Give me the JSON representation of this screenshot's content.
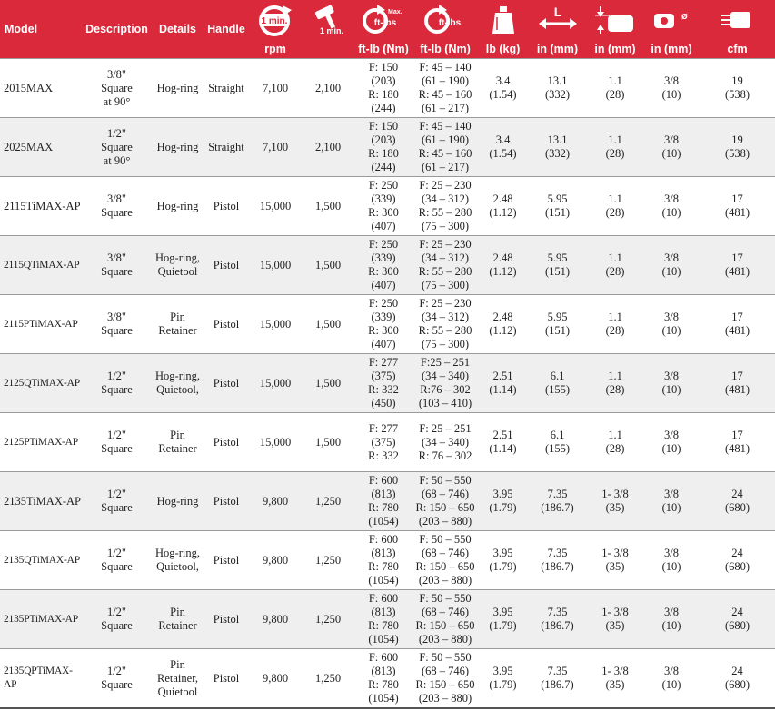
{
  "header": {
    "model": "Model",
    "description": "Description",
    "details": "Details",
    "handle": "Handle",
    "icon_1min_a": "1 min.",
    "icon_1min_b": "1 min.",
    "icon_max_label": "Max.",
    "icon_ftlbs_a": "ft-lbs",
    "icon_ftlbs_b": "ft-lbs",
    "icon_L": "L",
    "icon_diam": "ø",
    "units": [
      "rpm",
      "",
      "ft-lb (Nm)",
      "ft-lb (Nm)",
      "lb (kg)",
      "in (mm)",
      "in (mm)",
      "in (mm)",
      "cfm"
    ]
  },
  "rows": [
    {
      "model": "2015MAX",
      "description": [
        "3/8\"",
        "Square",
        "at 90°"
      ],
      "details": [
        "Hog-ring"
      ],
      "handle": "Straight",
      "rpm": "7,100",
      "bpm": "2,100",
      "torque_max": [
        "F: 150",
        "(203)",
        "R: 180",
        "(244)"
      ],
      "torque_range": [
        "F: 45 – 140",
        "(61 – 190)",
        "R: 45 – 160",
        "(61 – 217)"
      ],
      "weight": [
        "3.4",
        "(1.54)"
      ],
      "length": [
        "13.1",
        "(332)"
      ],
      "side": [
        "1.1",
        "(28)"
      ],
      "inlet": [
        "3/8",
        "(10)"
      ],
      "air": [
        "19",
        "(538)"
      ]
    },
    {
      "model": "2025MAX",
      "description": [
        "1/2\"",
        "Square",
        "at 90°"
      ],
      "details": [
        "Hog-ring"
      ],
      "handle": "Straight",
      "rpm": "7,100",
      "bpm": "2,100",
      "torque_max": [
        "F: 150",
        "(203)",
        "R: 180",
        "(244)"
      ],
      "torque_range": [
        "F: 45 – 140",
        "(61 – 190)",
        "R: 45 – 160",
        "(61 – 217)"
      ],
      "weight": [
        "3.4",
        "(1.54)"
      ],
      "length": [
        "13.1",
        "(332)"
      ],
      "side": [
        "1.1",
        "(28)"
      ],
      "inlet": [
        "3/8",
        "(10)"
      ],
      "air": [
        "19",
        "(538)"
      ]
    },
    {
      "model": "2115TiMAX-AP",
      "description": [
        "3/8\"",
        "Square"
      ],
      "details": [
        "Hog-ring"
      ],
      "handle": "Pistol",
      "rpm": "15,000",
      "bpm": "1,500",
      "torque_max": [
        "F: 250",
        "(339)",
        "R: 300",
        "(407)"
      ],
      "torque_range": [
        "F: 25 – 230",
        "(34 – 312)",
        "R: 55 – 280",
        "(75 – 300)"
      ],
      "weight": [
        "2.48",
        "(1.12)"
      ],
      "length": [
        "5.95",
        "(151)"
      ],
      "side": [
        "1.1",
        "(28)"
      ],
      "inlet": [
        "3/8",
        "(10)"
      ],
      "air": [
        "17",
        "(481)"
      ]
    },
    {
      "model": "2115QTiMAX-AP",
      "description": [
        "3/8\"",
        "Square"
      ],
      "details": [
        "Hog-ring,",
        "Quietool"
      ],
      "handle": "Pistol",
      "rpm": "15,000",
      "bpm": "1,500",
      "torque_max": [
        "F: 250",
        "(339)",
        "R: 300",
        "(407)"
      ],
      "torque_range": [
        "F: 25 – 230",
        "(34 – 312)",
        "R: 55 – 280",
        "(75 – 300)"
      ],
      "weight": [
        "2.48",
        "(1.12)"
      ],
      "length": [
        "5.95",
        "(151)"
      ],
      "side": [
        "1.1",
        "(28)"
      ],
      "inlet": [
        "3/8",
        "(10)"
      ],
      "air": [
        "17",
        "(481)"
      ]
    },
    {
      "model": "2115PTiMAX-AP",
      "description": [
        "3/8\"",
        "Square"
      ],
      "details": [
        "Pin",
        "Retainer"
      ],
      "handle": "Pistol",
      "rpm": "15,000",
      "bpm": "1,500",
      "torque_max": [
        "F: 250",
        "(339)",
        "R: 300",
        "(407)"
      ],
      "torque_range": [
        "F: 25 – 230",
        "(34 – 312)",
        "R: 55 – 280",
        "(75 – 300)"
      ],
      "weight": [
        "2.48",
        "(1.12)"
      ],
      "length": [
        "5.95",
        "(151)"
      ],
      "side": [
        "1.1",
        "(28)"
      ],
      "inlet": [
        "3/8",
        "(10)"
      ],
      "air": [
        "17",
        "(481)"
      ]
    },
    {
      "model": "2125QTiMAX-AP",
      "description": [
        "1/2\"",
        "Square"
      ],
      "details": [
        "Hog-ring,",
        "Quietool,"
      ],
      "handle": "Pistol",
      "rpm": "15,000",
      "bpm": "1,500",
      "torque_max": [
        "F: 277",
        "(375)",
        "R: 332",
        "(450)"
      ],
      "torque_range": [
        "F:25 – 251",
        "(34 – 340)",
        "R:76 – 302",
        "(103 – 410)"
      ],
      "weight": [
        "2.51",
        "(1.14)"
      ],
      "length": [
        "6.1",
        "(155)"
      ],
      "side": [
        "1.1",
        "(28)"
      ],
      "inlet": [
        "3/8",
        "(10)"
      ],
      "air": [
        "17",
        "(481)"
      ]
    },
    {
      "model": "2125PTiMAX-AP",
      "description": [
        "1/2\"",
        "Square"
      ],
      "details": [
        "Pin",
        "Retainer"
      ],
      "handle": "Pistol",
      "rpm": "15,000",
      "bpm": "1,500",
      "torque_max": [
        "F: 277",
        "(375)",
        "R: 332"
      ],
      "torque_range": [
        "F: 25 – 251",
        "(34 – 340)",
        "R: 76 – 302"
      ],
      "weight": [
        "2.51",
        "(1.14)"
      ],
      "length": [
        "6.1",
        "(155)"
      ],
      "side": [
        "1.1",
        "(28)"
      ],
      "inlet": [
        "3/8",
        "(10)"
      ],
      "air": [
        "17",
        "(481)"
      ]
    },
    {
      "model": "2135TiMAX-AP",
      "description": [
        "1/2\"",
        "Square"
      ],
      "details": [
        "Hog-ring"
      ],
      "handle": "Pistol",
      "rpm": "9,800",
      "bpm": "1,250",
      "torque_max": [
        "F: 600",
        "(813)",
        "R: 780",
        "(1054)"
      ],
      "torque_range": [
        "F: 50 – 550",
        "(68 – 746)",
        "R: 150 – 650",
        "(203 – 880)"
      ],
      "weight": [
        "3.95",
        "(1.79)"
      ],
      "length": [
        "7.35",
        "(186.7)"
      ],
      "side": [
        "1- 3/8",
        "(35)"
      ],
      "inlet": [
        "3/8",
        "(10)"
      ],
      "air": [
        "24",
        "(680)"
      ]
    },
    {
      "model": "2135QTiMAX-AP",
      "description": [
        "1/2\"",
        "Square"
      ],
      "details": [
        "Hog-ring,",
        "Quietool,"
      ],
      "handle": "Pistol",
      "rpm": "9,800",
      "bpm": "1,250",
      "torque_max": [
        "F: 600",
        "(813)",
        "R: 780",
        "(1054)"
      ],
      "torque_range": [
        "F: 50 – 550",
        "(68 – 746)",
        "R: 150 – 650",
        "(203 – 880)"
      ],
      "weight": [
        "3.95",
        "(1.79)"
      ],
      "length": [
        "7.35",
        "(186.7)"
      ],
      "side": [
        "1- 3/8",
        "(35)"
      ],
      "inlet": [
        "3/8",
        "(10)"
      ],
      "air": [
        "24",
        "(680)"
      ]
    },
    {
      "model": "2135PTiMAX-AP",
      "description": [
        "1/2\"",
        "Square"
      ],
      "details": [
        "Pin",
        "Retainer"
      ],
      "handle": "Pistol",
      "rpm": "9,800",
      "bpm": "1,250",
      "torque_max": [
        "F: 600",
        "(813)",
        "R: 780",
        "(1054)"
      ],
      "torque_range": [
        "F: 50 – 550",
        "(68 – 746)",
        "R: 150 – 650",
        "(203 – 880)"
      ],
      "weight": [
        "3.95",
        "(1.79)"
      ],
      "length": [
        "7.35",
        "(186.7)"
      ],
      "side": [
        "1- 3/8",
        "(35)"
      ],
      "inlet": [
        "3/8",
        "(10)"
      ],
      "air": [
        "24",
        "(680)"
      ]
    },
    {
      "model": "2135QPTiMAX-AP",
      "description": [
        "1/2\"",
        "Square"
      ],
      "details": [
        "Pin",
        "Retainer,",
        "Quietool"
      ],
      "handle": "Pistol",
      "rpm": "9,800",
      "bpm": "1,250",
      "torque_max": [
        "F: 600",
        "(813)",
        "R: 780",
        "(1054)"
      ],
      "torque_range": [
        "F: 50 – 550",
        "(68 – 746)",
        "R: 150 – 650",
        "(203 – 880)"
      ],
      "weight": [
        "3.95",
        "(1.79)"
      ],
      "length": [
        "7.35",
        "(186.7)"
      ],
      "side": [
        "1- 3/8",
        "(35)"
      ],
      "inlet": [
        "3/8",
        "(10)"
      ],
      "air": [
        "24",
        "(680)"
      ]
    }
  ]
}
